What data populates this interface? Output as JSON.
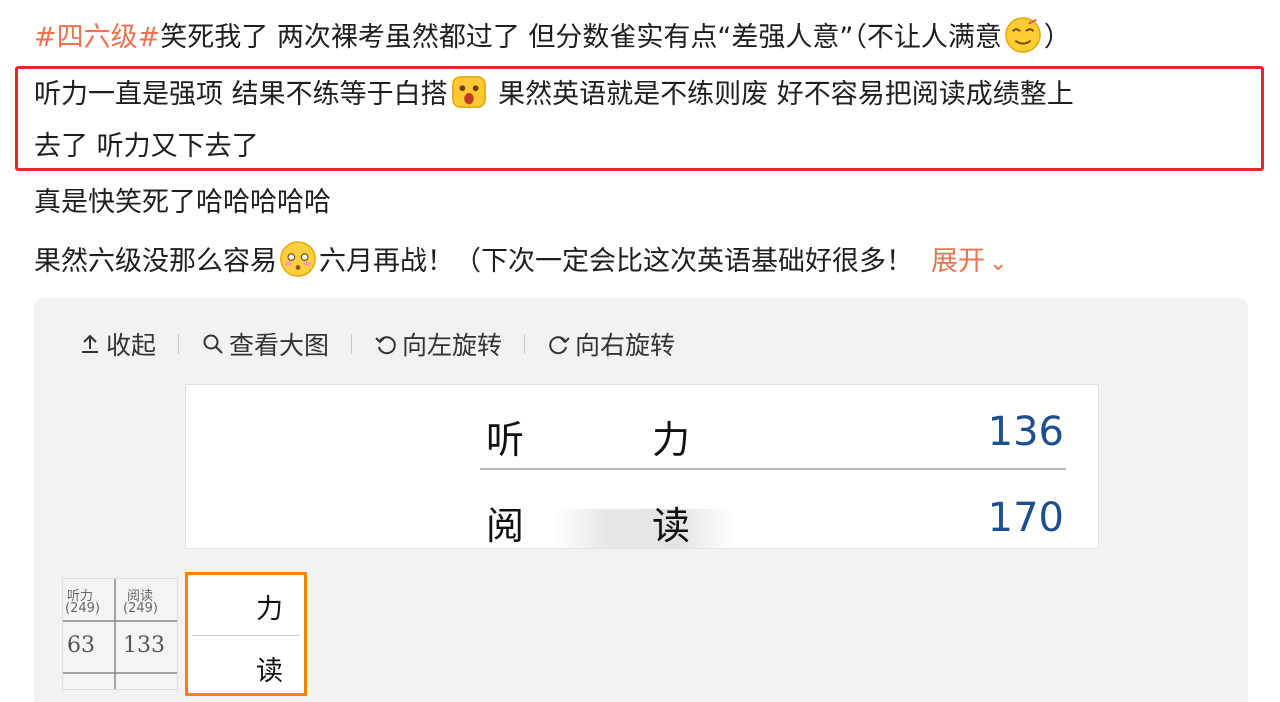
{
  "post": {
    "hashtag": "#四六级#",
    "line1_text": "笑死我了 两次裸考虽然都过了 但分数雀实有点“差强人意”（不让人满意",
    "line1_close": "）",
    "line1_emoji": "smug-face-emoji",
    "line2a_text": "听力一直是强项 结果不练等于白搭",
    "line2_emoji": "shocked-face-emoji",
    "line2b_text": " 果然英语就是不练则废 好不容易把阅读成绩整上",
    "line3_text": "去了 听力又下去了",
    "line4_text": "真是快笑死了哈哈哈哈哈",
    "line5a_text": "果然六级没那么容易",
    "line5_emoji": "flushed-face-emoji",
    "line5b_text": "六月再战！（下次一定会比这次英语基础好很多！",
    "expand_label": "展开",
    "accent_color": "#eb7350",
    "highlight_color": "#e8262b"
  },
  "toolbar": {
    "collapse_label": "收起",
    "view_large_label": "查看大图",
    "rotate_left_label": "向左旋转",
    "rotate_right_label": "向右旋转",
    "icons": [
      "collapse-up-icon",
      "search-icon",
      "rotate-left-icon",
      "rotate-right-icon"
    ]
  },
  "score_image": {
    "rows": [
      {
        "label_a": "听",
        "label_b": "力",
        "value": "136"
      },
      {
        "label_a": "阅",
        "label_b": "读",
        "value": "170"
      }
    ],
    "value_color": "#1d4f91"
  },
  "thumbnails": {
    "thumb1": {
      "headers": [
        "听力",
        "阅读"
      ],
      "subheaders": [
        "(249)",
        "(249)"
      ],
      "values": [
        "63",
        "133"
      ]
    },
    "thumb2": {
      "labels": [
        "力",
        "读"
      ],
      "border_color": "#ff8200"
    }
  }
}
